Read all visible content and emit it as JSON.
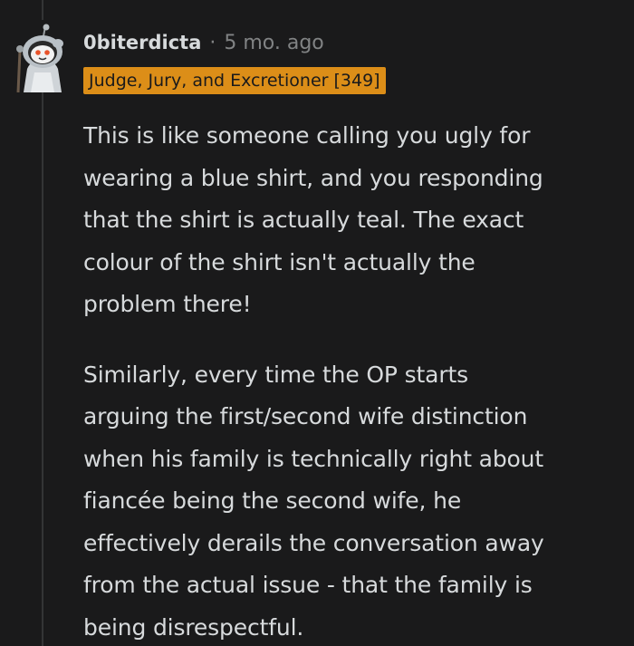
{
  "comment": {
    "author": "0biterdicta",
    "separator": "·",
    "time": "5 mo. ago",
    "flair": "Judge, Jury, and Excretioner [349]",
    "paragraphs": [
      [
        "This is like someone calling you ugly for",
        "wearing a blue shirt, and you responding",
        "that the shirt is actually teal. The exact",
        "colour of the shirt isn't actually the",
        "problem there!"
      ],
      [
        "Similarly, every time the OP starts",
        "arguing the first/second wife distinction",
        "when his family is technically right about",
        "fiancée being the second wife, he",
        "effectively derails the conversation away",
        "from the actual issue - that the family is",
        "being disrespectful."
      ]
    ],
    "avatar_icon": "snoo-avatar-icon"
  },
  "colors": {
    "background": "#1a1a1b",
    "text": "#d7dadc",
    "muted": "#818384",
    "flair_bg": "#dc8e18",
    "thread_line": "#343536"
  }
}
